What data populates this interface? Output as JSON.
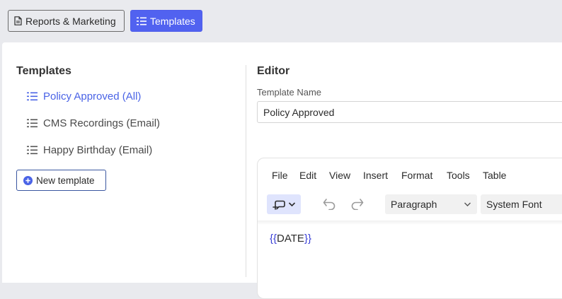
{
  "topnav": {
    "reports_label": "Reports & Marketing",
    "templates_label": "Templates"
  },
  "templates_panel": {
    "heading": "Templates",
    "items": [
      {
        "label": "Policy Approved (All)",
        "active": true
      },
      {
        "label": "CMS Recordings (Email)",
        "active": false
      },
      {
        "label": "Happy Birthday (Email)",
        "active": false
      }
    ],
    "new_button_label": "New template"
  },
  "editor_panel": {
    "heading": "Editor",
    "name_label": "Template Name",
    "name_value": "Policy Approved",
    "menu": [
      "File",
      "Edit",
      "View",
      "Insert",
      "Format",
      "Tools",
      "Table"
    ],
    "block_format": "Paragraph",
    "font_family": "System Font",
    "content": {
      "open_brace": "{{",
      "token": "DATE",
      "close_brace": "}}"
    }
  },
  "colors": {
    "accent": "#5162f0",
    "active_item": "#4a63e6",
    "page_bg": "#e9eaee"
  }
}
